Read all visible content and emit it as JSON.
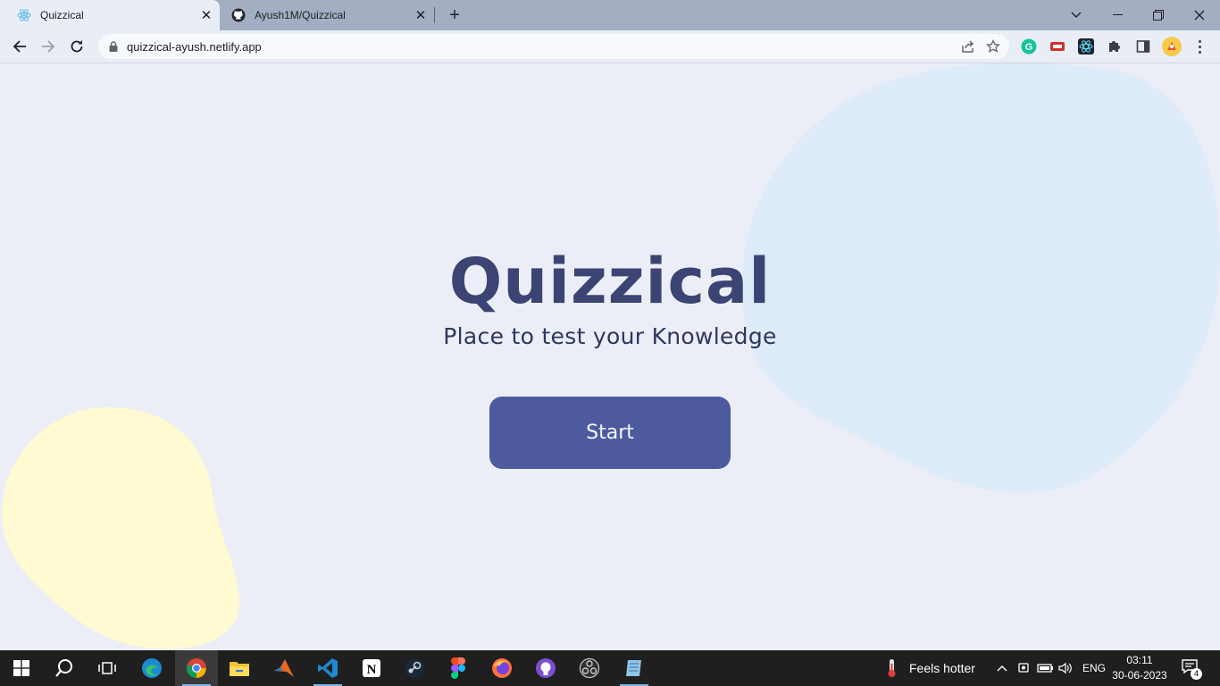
{
  "browser": {
    "tabs": [
      {
        "title": "Quizzical",
        "active": true,
        "icon": "react-icon"
      },
      {
        "title": "Ayush1M/Quizzical",
        "active": false,
        "icon": "github-icon"
      }
    ],
    "url": "quizzical-ayush.netlify.app"
  },
  "page": {
    "title": "Quizzical",
    "subtitle": "Place to test your Knowledge",
    "start_label": "Start",
    "colors": {
      "background": "#ebeef6",
      "heading": "#3b4473",
      "button": "#4d5b9e",
      "blob_yellow": "#fffad1",
      "blob_blue": "#deebf8"
    }
  },
  "taskbar": {
    "weather_text": "Feels hotter",
    "language": "ENG",
    "time": "03:11",
    "date": "30-06-2023",
    "notification_count": "4",
    "apps": [
      "windows-start",
      "search",
      "task-view",
      "edge",
      "chrome",
      "file-explorer",
      "matlab",
      "vscode",
      "notion",
      "steam",
      "figma",
      "firefox",
      "github-desktop",
      "obs",
      "notepad"
    ]
  }
}
